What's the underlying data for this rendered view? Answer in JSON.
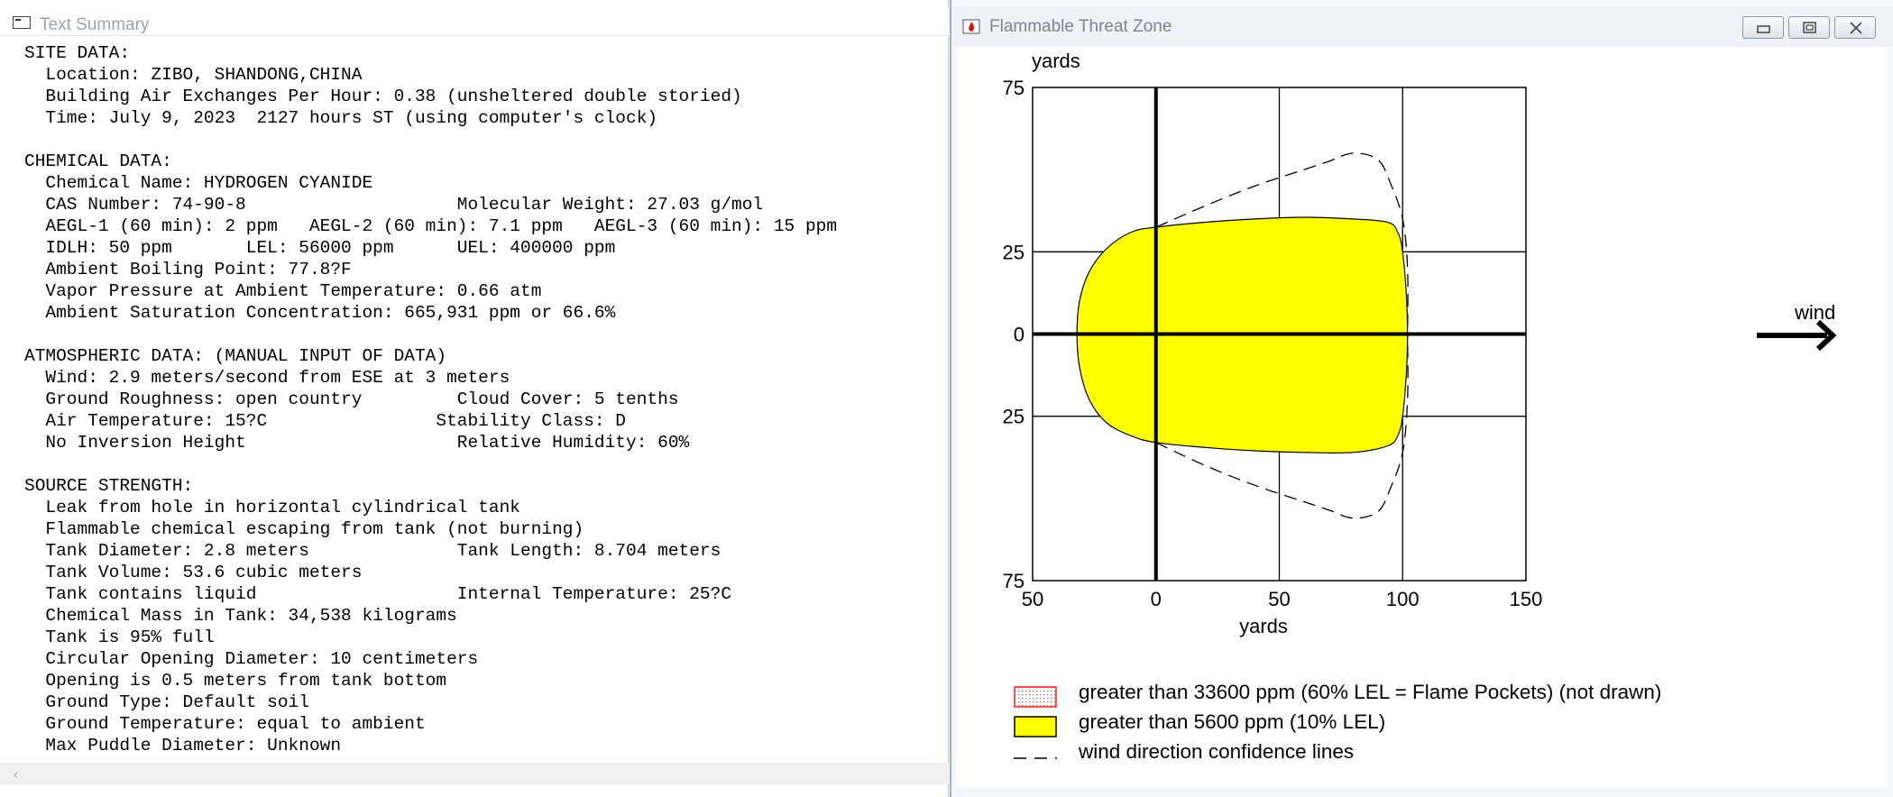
{
  "left_window": {
    "title": "Text Summary",
    "lines": [
      "SITE DATA:",
      "  Location: ZIBO, SHANDONG,CHINA",
      "  Building Air Exchanges Per Hour: 0.38 (unsheltered double storied)",
      "  Time: July 9, 2023  2127 hours ST (using computer's clock)",
      "",
      "CHEMICAL DATA:",
      "  Chemical Name: HYDROGEN CYANIDE",
      "  CAS Number: 74-90-8                    Molecular Weight: 27.03 g/mol",
      "  AEGL-1 (60 min): 2 ppm   AEGL-2 (60 min): 7.1 ppm   AEGL-3 (60 min): 15 ppm",
      "  IDLH: 50 ppm       LEL: 56000 ppm      UEL: 400000 ppm",
      "  Ambient Boiling Point: 77.8?F",
      "  Vapor Pressure at Ambient Temperature: 0.66 atm",
      "  Ambient Saturation Concentration: 665,931 ppm or 66.6%",
      "",
      "ATMOSPHERIC DATA: (MANUAL INPUT OF DATA)",
      "  Wind: 2.9 meters/second from ESE at 3 meters",
      "  Ground Roughness: open country         Cloud Cover: 5 tenths",
      "  Air Temperature: 15?C                Stability Class: D",
      "  No Inversion Height                    Relative Humidity: 60%",
      "",
      "SOURCE STRENGTH:",
      "  Leak from hole in horizontal cylindrical tank",
      "  Flammable chemical escaping from tank (not burning)",
      "  Tank Diameter: 2.8 meters              Tank Length: 8.704 meters",
      "  Tank Volume: 53.6 cubic meters",
      "  Tank contains liquid                   Internal Temperature: 25?C",
      "  Chemical Mass in Tank: 34,538 kilograms",
      "  Tank is 95% full",
      "  Circular Opening Diameter: 10 centimeters",
      "  Opening is 0.5 meters from tank bottom",
      "  Ground Type: Default soil",
      "  Ground Temperature: equal to ambient",
      "  Max Puddle Diameter: Unknown"
    ],
    "scroll_left_arrow": "‹"
  },
  "right_window": {
    "title": "Flammable Threat Zone",
    "icon": "fire-icon",
    "buttons": [
      "minimize-icon",
      "maximize-icon",
      "close-icon"
    ],
    "wind_label": "wind",
    "legend": [
      {
        "label": "greater than 33600 ppm (60% LEL = Flame Pockets) (not drawn)",
        "swatch": "red-dotted",
        "color": "#ff2020"
      },
      {
        "label": "greater than 5600 ppm (10% LEL)",
        "swatch": "yellow-fill",
        "color": "#ffff00"
      },
      {
        "label": "wind direction confidence lines",
        "swatch": "dashed-line",
        "color": "#000000"
      }
    ]
  },
  "chart_data": {
    "type": "area",
    "xlabel": "yards",
    "ylabel": "yards",
    "x_ticks": [
      "50",
      "0",
      "50",
      "100",
      "150"
    ],
    "y_ticks": [
      "75",
      "25",
      "0",
      "25",
      "75"
    ],
    "xlim": [
      -50,
      150
    ],
    "ylim": [
      -75,
      75
    ],
    "grid": true,
    "fill_color": "#ffff00",
    "series": [
      {
        "name": "greater than 5600 ppm (10% LEL)",
        "outline": [
          [
            -32,
            0
          ],
          [
            -31,
            10
          ],
          [
            -27,
            19
          ],
          [
            -20,
            26
          ],
          [
            -10,
            31
          ],
          [
            0,
            32.5
          ],
          [
            20,
            34
          ],
          [
            40,
            35
          ],
          [
            60,
            35.5
          ],
          [
            80,
            35
          ],
          [
            94,
            34
          ],
          [
            98,
            31
          ],
          [
            100,
            25
          ],
          [
            101.5,
            12
          ],
          [
            102,
            0
          ],
          [
            101.5,
            -12
          ],
          [
            100,
            -25
          ],
          [
            98,
            -31
          ],
          [
            94,
            -34
          ],
          [
            80,
            -36
          ],
          [
            60,
            -36
          ],
          [
            40,
            -35.5
          ],
          [
            20,
            -34.5
          ],
          [
            0,
            -33
          ],
          [
            -10,
            -31
          ],
          [
            -20,
            -27
          ],
          [
            -27,
            -20
          ],
          [
            -31,
            -10
          ]
        ]
      },
      {
        "name": "wind direction confidence lines",
        "upper": [
          [
            0,
            32.5
          ],
          [
            20,
            39
          ],
          [
            40,
            45
          ],
          [
            60,
            50
          ],
          [
            70,
            52.5
          ],
          [
            80,
            55
          ],
          [
            90,
            53
          ],
          [
            95,
            46
          ],
          [
            100,
            35
          ],
          [
            102,
            20
          ],
          [
            102,
            0
          ]
        ],
        "lower": [
          [
            0,
            -33
          ],
          [
            20,
            -40
          ],
          [
            40,
            -46
          ],
          [
            60,
            -51
          ],
          [
            70,
            -53.5
          ],
          [
            80,
            -56
          ],
          [
            90,
            -54
          ],
          [
            95,
            -47
          ],
          [
            100,
            -36
          ],
          [
            102,
            -20
          ],
          [
            102,
            0
          ]
        ]
      }
    ]
  }
}
